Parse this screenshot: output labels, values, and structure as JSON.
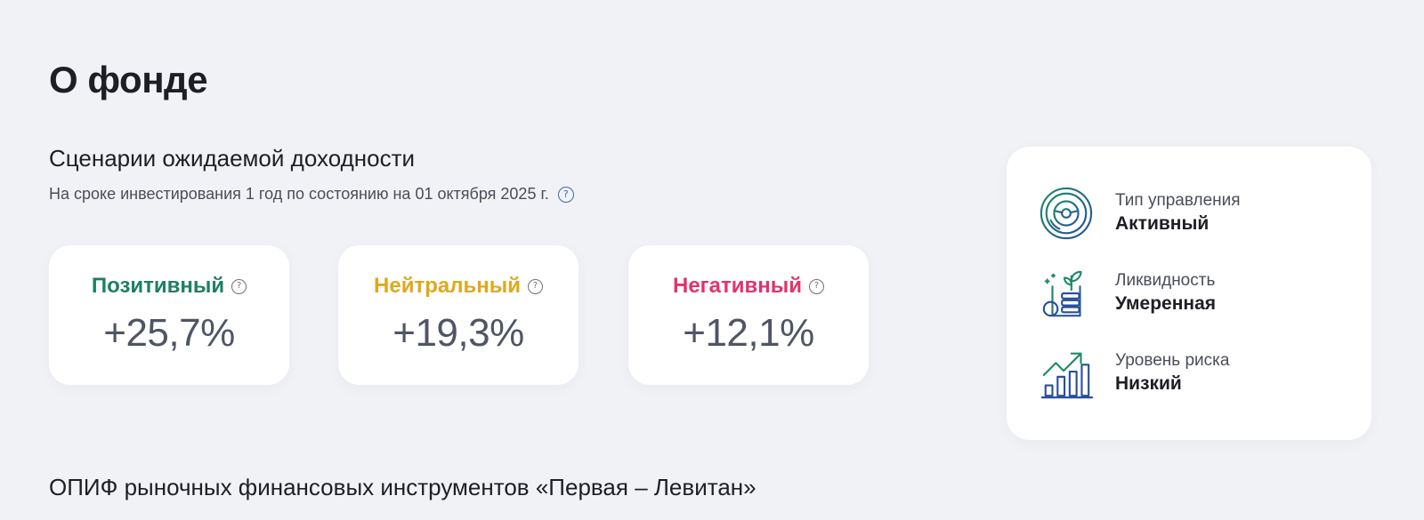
{
  "page_title": "О фонде",
  "scenarios": {
    "title": "Сценарии ожидаемой доходности",
    "subtitle": "На сроке инвестирования 1 год по состоянию на 01 октября 2025 г.",
    "help_icon": "question-circle-icon",
    "cards": [
      {
        "label": "Позитивный",
        "value": "+25,7%",
        "color": "#1e7f63"
      },
      {
        "label": "Нейтральный",
        "value": "+19,3%",
        "color": "#e0a81c"
      },
      {
        "label": "Негативный",
        "value": "+12,1%",
        "color": "#e2336b"
      }
    ]
  },
  "fund_info": {
    "items": [
      {
        "label": "Тип управления",
        "value": "Активный",
        "icon": "steering-wheel-icon"
      },
      {
        "label": "Ликвидность",
        "value": "Умеренная",
        "icon": "coins-plant-icon"
      },
      {
        "label": "Уровень риска",
        "value": "Низкий",
        "icon": "growth-chart-icon"
      }
    ]
  },
  "fund_name": "ОПИФ рыночных финансовых инструментов «Первая – Левитан»",
  "colors": {
    "background": "#f1f2f6",
    "card": "#ffffff",
    "icon_green": "#1e8a6a",
    "icon_blue": "#2a4f9c"
  }
}
